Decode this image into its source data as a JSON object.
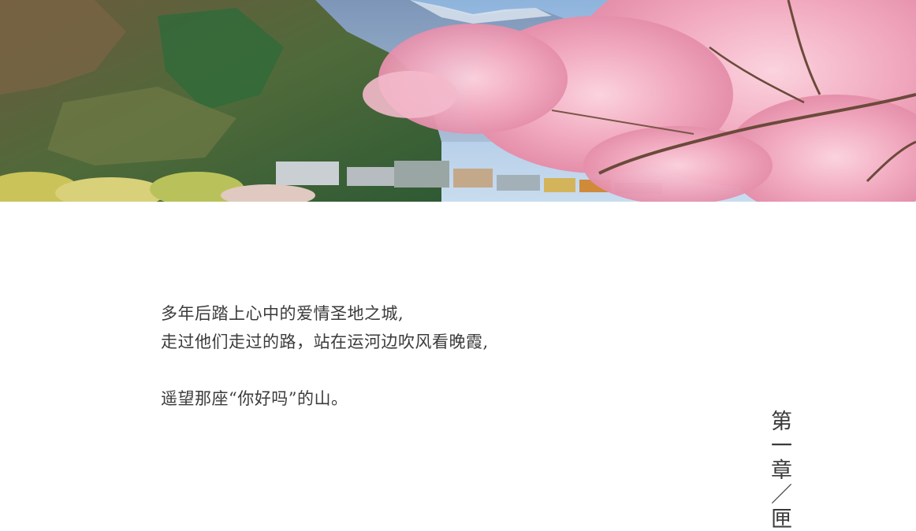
{
  "poem": {
    "lines": [
      "多年后踏上心中的爱情圣地之城,",
      "走过他们走过的路，站在运河边吹风看晚霞,",
      "",
      "遥望那座“你好吗”的山。"
    ]
  },
  "chapter": {
    "heading": "第一章／匣"
  },
  "colors": {
    "sky": "#9cc0e0",
    "mountain": "#6a8ab0",
    "forest": "#3f6b3a",
    "blossom": "#f3b3c6",
    "text": "#3b3b3b"
  }
}
